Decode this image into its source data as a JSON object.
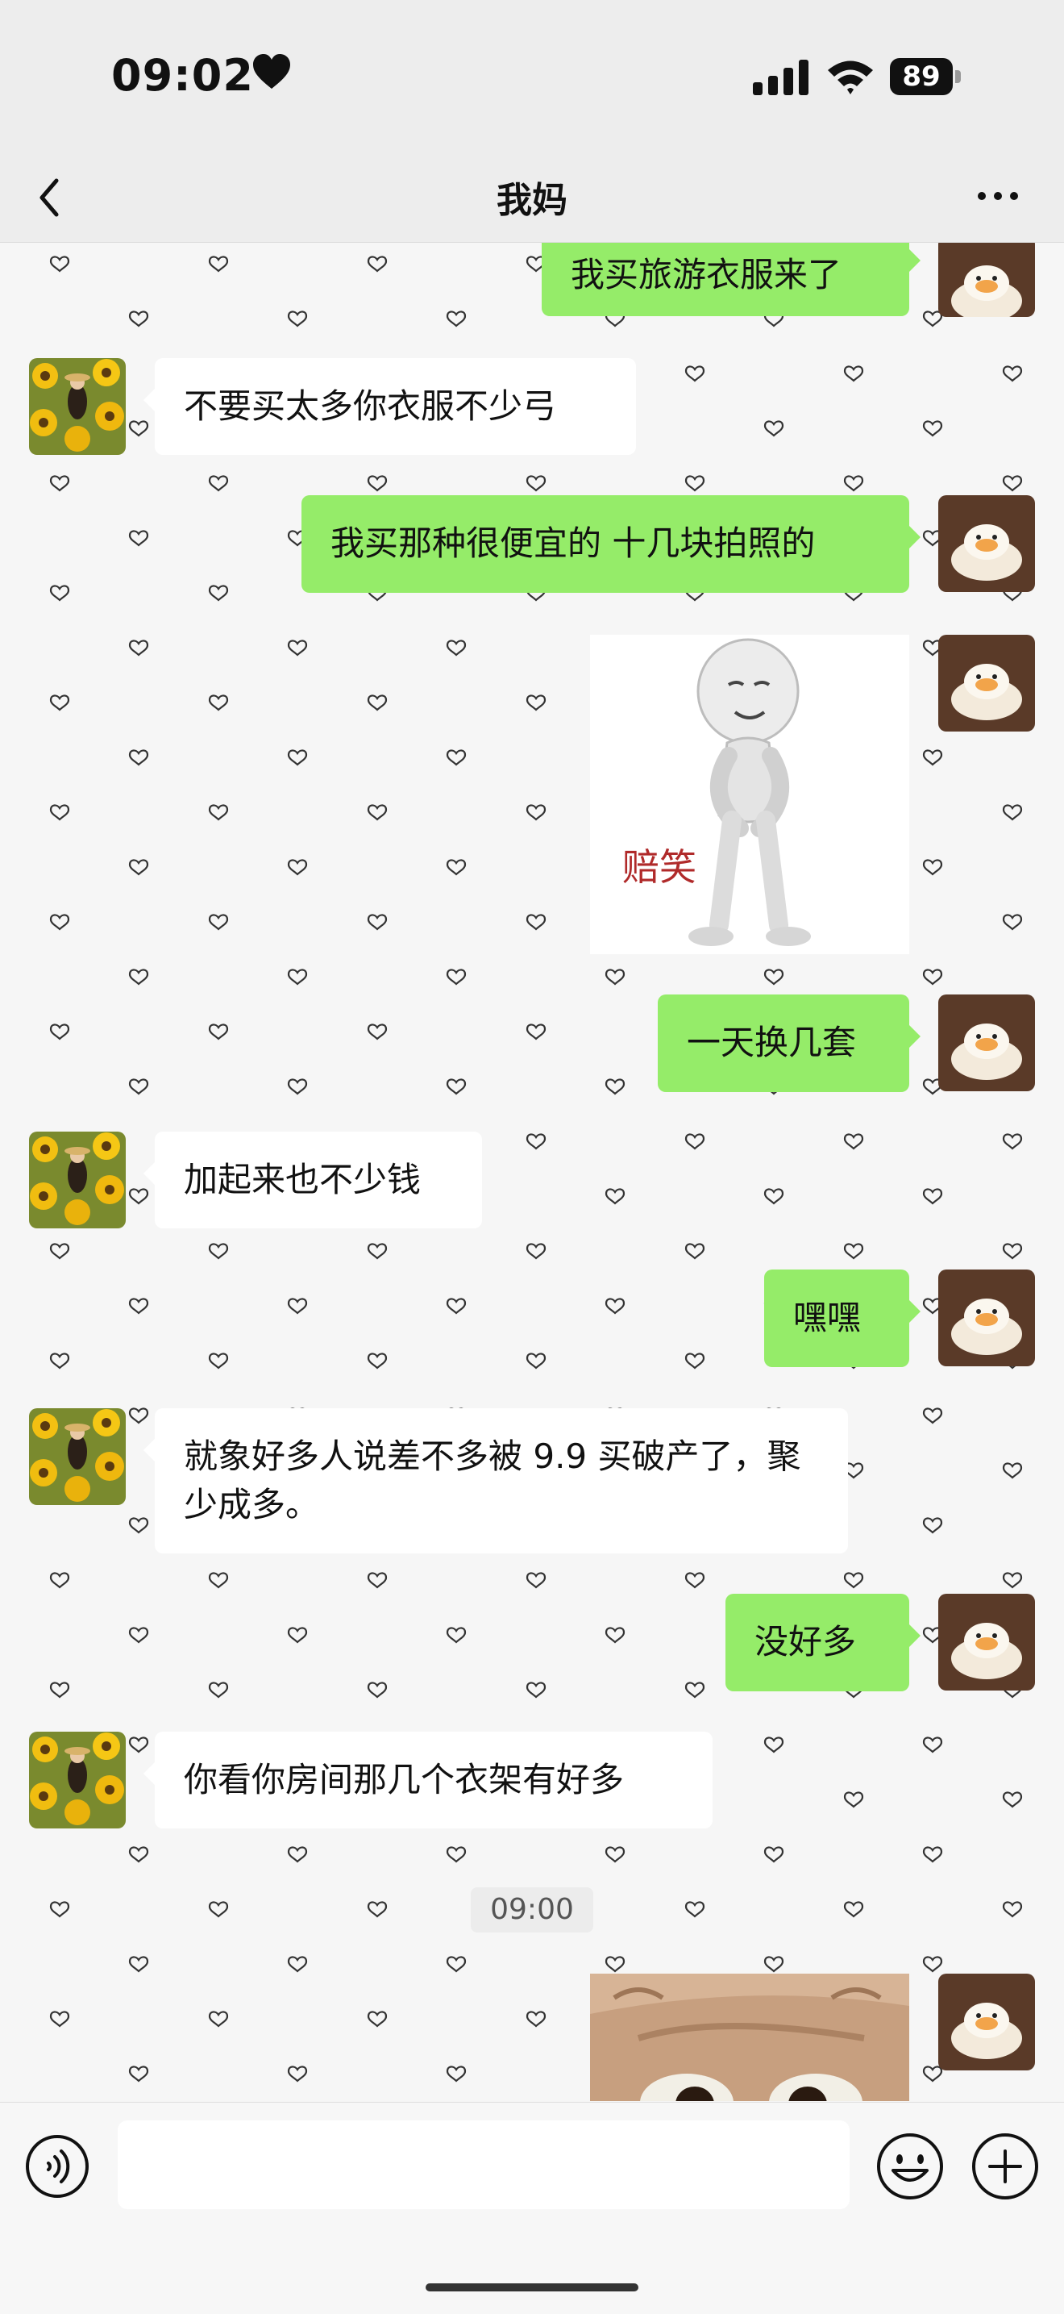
{
  "status_bar": {
    "time": "09:02",
    "battery": "89"
  },
  "nav": {
    "title": "我妈"
  },
  "messages": [
    {
      "side": "out",
      "text": "我买旅游衣服来了"
    },
    {
      "side": "in",
      "text": "不要买太多你衣服不少弓"
    },
    {
      "side": "out",
      "text": "我买那种很便宜的 十几块拍照的"
    },
    {
      "side": "out",
      "type": "sticker",
      "caption": "赔笑"
    },
    {
      "side": "out",
      "text": "一天换几套"
    },
    {
      "side": "in",
      "text": "加起来也不少钱"
    },
    {
      "side": "out",
      "text": "嘿嘿"
    },
    {
      "side": "in",
      "text": "就象好多人说差不多被 9.9 买破产了，聚少成多。"
    },
    {
      "side": "out",
      "text": "没好多"
    },
    {
      "side": "in",
      "text": "你看你房间那几个衣架有好多"
    },
    {
      "side": "out",
      "type": "sticker",
      "caption": ""
    }
  ],
  "timestamp": "09:00",
  "input": {
    "value": ""
  },
  "icons": [
    "back-icon",
    "more-icon",
    "voice-icon",
    "emoji-icon",
    "plus-icon",
    "heart-icon",
    "signal-icon",
    "wifi-icon"
  ],
  "colors": {
    "outgoing_bubble": "#95ec69",
    "incoming_bubble": "#ffffff",
    "background": "#f6f6f6"
  }
}
